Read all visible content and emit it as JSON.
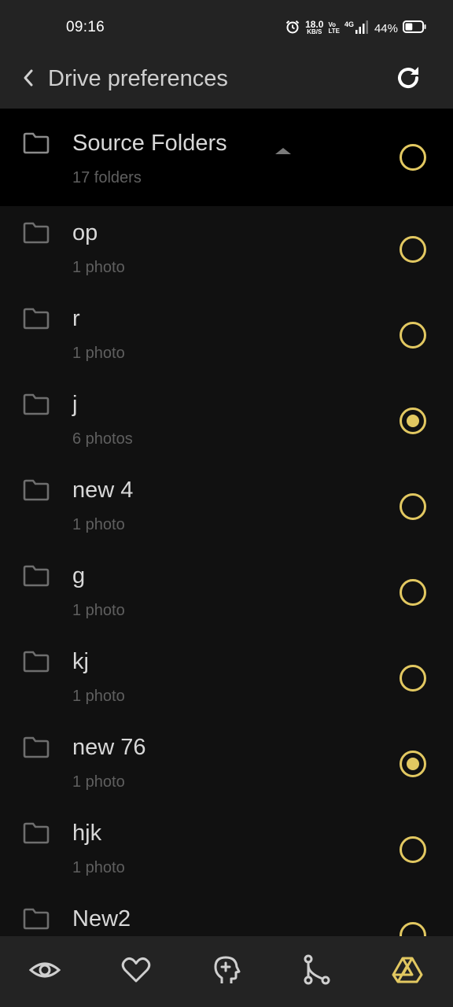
{
  "status_bar": {
    "time": "09:16",
    "net_speed_value": "18.0",
    "net_speed_unit": "KB/S",
    "volte_top": "Vo",
    "volte_bottom": "LTE",
    "network_type": "4G",
    "battery_percent": "44%",
    "battery_level": 0.44,
    "icons": [
      "alarm-icon",
      "signal-icon",
      "battery-icon"
    ]
  },
  "app_bar": {
    "title": "Drive preferences",
    "back_icon": "chevron-left-icon",
    "refresh_icon": "refresh-icon"
  },
  "source_header": {
    "title": "Source Folders",
    "subtitle": "17 folders",
    "expanded": true,
    "selected": false
  },
  "folders": [
    {
      "name": "op",
      "count": "1 photo",
      "selected": false
    },
    {
      "name": "r",
      "count": "1 photo",
      "selected": false
    },
    {
      "name": "j",
      "count": "6 photos",
      "selected": true
    },
    {
      "name": "new 4",
      "count": "1 photo",
      "selected": false
    },
    {
      "name": "g",
      "count": "1 photo",
      "selected": false
    },
    {
      "name": "kj",
      "count": "1 photo",
      "selected": false
    },
    {
      "name": "new 76",
      "count": "1 photo",
      "selected": true
    },
    {
      "name": "hjk",
      "count": "1 photo",
      "selected": false
    },
    {
      "name": "New2",
      "count": "",
      "selected": false
    }
  ],
  "bottom_nav": {
    "items": [
      "eye-icon",
      "heart-icon",
      "head-plus-icon",
      "branch-icon",
      "drive-icon"
    ],
    "active": "drive-icon"
  },
  "colors": {
    "accent": "#e2c861",
    "background": "#111111",
    "bar": "#232323",
    "header": "#000000",
    "text": "#d8d8d8",
    "subtext": "#5f5f5f"
  }
}
